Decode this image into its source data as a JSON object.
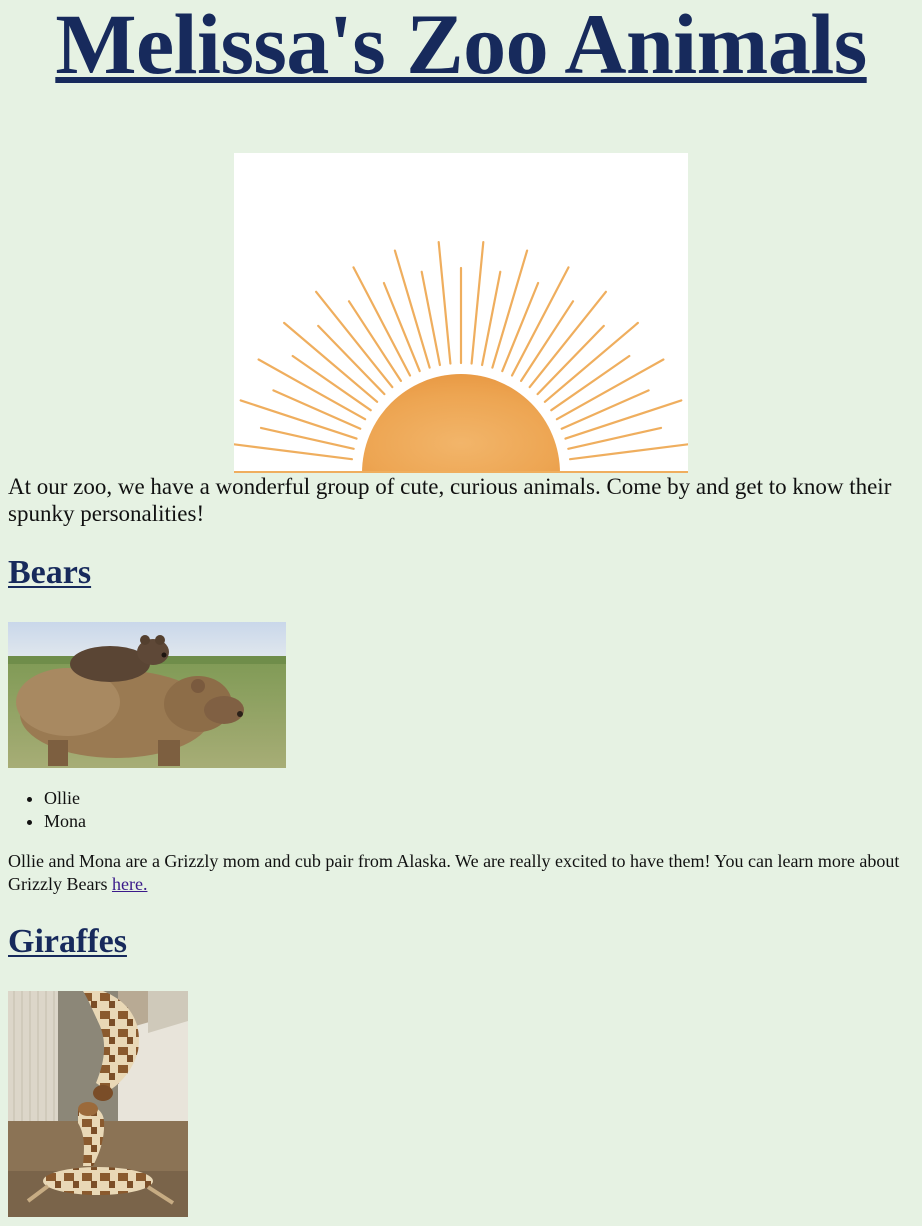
{
  "header": {
    "title": "Melissa's Zoo Animals"
  },
  "hero": {
    "image": "sunrise-illustration",
    "colors": {
      "sun": "#efa84f",
      "rays": "#efae5e",
      "background": "#ffffff"
    }
  },
  "intro": {
    "text": "At our zoo, we have a wonderful group of cute, curious animals. Come by and get to know their spunky personalities!"
  },
  "sections": {
    "bears": {
      "heading": "Bears",
      "photo": "grizzly-mom-and-cub-photo",
      "names": [
        "Ollie",
        "Mona"
      ],
      "description": "Ollie and Mona are a Grizzly mom and cub pair from Alaska. We are really excited to have them! You can learn more about Grizzly Bears ",
      "link_text": "here."
    },
    "giraffes": {
      "heading": "Giraffes",
      "photo": "giraffe-mother-and-calf-photo"
    }
  },
  "theme": {
    "background": "#e6f2e3",
    "heading_color": "#172a5c",
    "link_color": "#3a1a8a"
  }
}
